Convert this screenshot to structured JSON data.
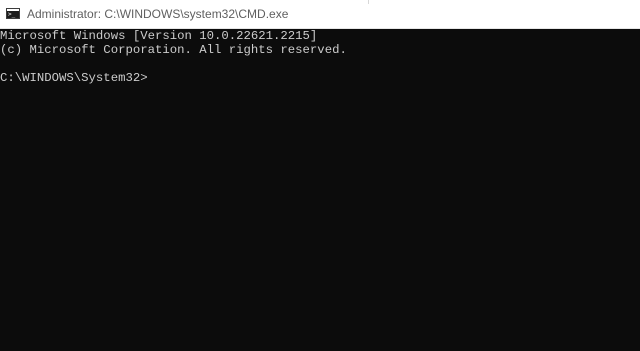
{
  "window": {
    "title": "Administrator: C:\\WINDOWS\\system32\\CMD.exe",
    "icon": "cmd-icon"
  },
  "console": {
    "lines": [
      "Microsoft Windows [Version 10.0.22621.2215]",
      "(c) Microsoft Corporation. All rights reserved.",
      "",
      "C:\\WINDOWS\\System32>"
    ],
    "prompt": "C:\\WINDOWS\\System32>"
  },
  "colors": {
    "console_background": "#0c0c0c",
    "console_text": "#cccccc",
    "titlebar_background": "#ffffff",
    "title_text": "#5f5f5f"
  }
}
